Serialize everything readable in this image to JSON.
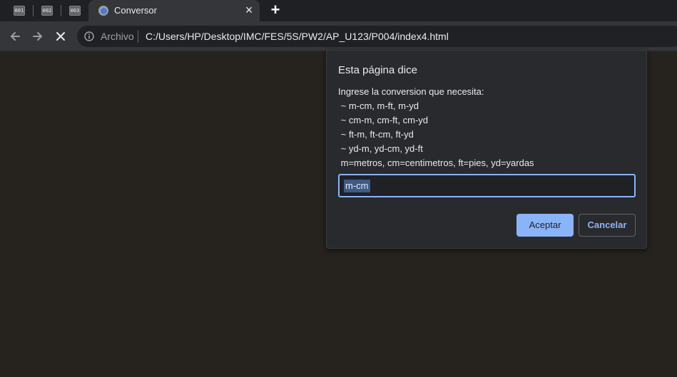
{
  "tabs": {
    "pinned": [
      {
        "label": "001"
      },
      {
        "label": "002"
      },
      {
        "label": "003"
      }
    ],
    "active": {
      "title": "Conversor",
      "close_glyph": "×"
    },
    "new_tab_glyph": "+"
  },
  "toolbar": {
    "back_icon": "back-arrow-icon",
    "forward_icon": "forward-arrow-icon",
    "reload_icon": "stop-loading-icon",
    "security_label": "Archivo",
    "url": "C:/Users/HP/Desktop/IMC/FES/5S/PW2/AP_U123/P004/index4.html"
  },
  "dialog": {
    "title": "Esta página dice",
    "message_lines": [
      "Ingrese la conversion que necesita:",
      " ~ m-cm, m-ft, m-yd",
      " ~ cm-m, cm-ft, cm-yd",
      " ~ ft-m, ft-cm, ft-yd",
      " ~ yd-m, yd-cm, yd-ft",
      " m=metros, cm=centimetros, ft=pies, yd=yardas"
    ],
    "input_value": "m-cm",
    "accept_label": "Aceptar",
    "cancel_label": "Cancelar"
  },
  "colors": {
    "page_background": "#26231f",
    "accent": "#8ab4f8"
  }
}
